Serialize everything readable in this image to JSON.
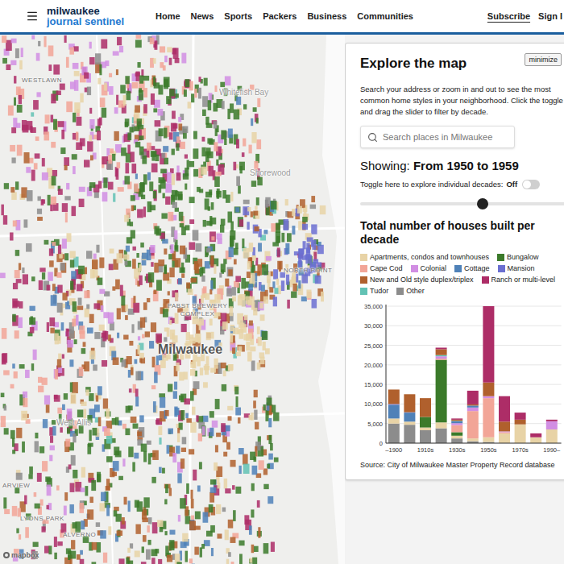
{
  "header": {
    "logo": {
      "line1": "milwaukee",
      "line2": "journal sentinel"
    },
    "nav": [
      {
        "label": "Home"
      },
      {
        "label": "News"
      },
      {
        "label": "Sports"
      },
      {
        "label": "Packers"
      },
      {
        "label": "Business"
      },
      {
        "label": "Communities"
      }
    ],
    "subscribe": "Subscribe",
    "sign_in": "Sign I"
  },
  "map": {
    "labels": [
      {
        "text": "WESTLAWN",
        "kind": "neighborhood"
      },
      {
        "text": "Whitefish Bay",
        "kind": "town"
      },
      {
        "text": "Shorewood",
        "kind": "town"
      },
      {
        "text": "NORTH POINT",
        "kind": "neighborhood"
      },
      {
        "text": "PABST BREWERY COMPLEX",
        "kind": "neighborhood"
      },
      {
        "text": "Milwaukee",
        "kind": "city"
      },
      {
        "text": "West Allis",
        "kind": "town"
      },
      {
        "text": "ARVIEW",
        "kind": "neighborhood"
      },
      {
        "text": "LYONS PARK",
        "kind": "neighborhood"
      },
      {
        "text": "ALVERNO",
        "kind": "neighborhood"
      }
    ],
    "attribution": "mapbox"
  },
  "panel": {
    "title": "Explore the map",
    "minimize": "minimize",
    "intro": "Search your address or zoom in and out to see the most common home styles in your neighborhood. Click the toggle and drag the slider to filter by decade.",
    "search": {
      "placeholder": "Search places in Milwaukee"
    },
    "showing_label": "Showing:",
    "showing_value": "From 1950 to 1959",
    "toggle": {
      "label": "Toggle here to explore individual decades:",
      "value": "Off",
      "on": false
    },
    "slider": {
      "level": 0.58
    },
    "chart": {
      "title": "Total number of houses built per decade",
      "y_ticks": [
        "0",
        "5,000",
        "10,000",
        "15,000",
        "20,000",
        "25,000",
        "30,000",
        "35,000"
      ],
      "x_labels": [
        "–1900",
        "",
        "1910s",
        "",
        "1930s",
        "",
        "1950s",
        "",
        "1970s",
        "",
        "1990–"
      ],
      "series": [
        {
          "name": "Apartments, condos and townhouses",
          "color": "#e8d3a6",
          "values": [
            1300,
            800,
            700,
            1500,
            700,
            700,
            1200,
            2500,
            4800,
            1500,
            3500
          ]
        },
        {
          "name": "Bungalow",
          "color": "#3b7a2a",
          "values": [
            0,
            0,
            2700,
            16000,
            900,
            0,
            0,
            0,
            0,
            0,
            0
          ]
        },
        {
          "name": "Cape Cod",
          "color": "#f2a597",
          "values": [
            0,
            0,
            0,
            300,
            1800,
            7000,
            10000,
            300,
            0,
            0,
            0
          ]
        },
        {
          "name": "Colonial",
          "color": "#d18ee3",
          "values": [
            0,
            0,
            0,
            600,
            500,
            900,
            500,
            200,
            0,
            0,
            2100
          ]
        },
        {
          "name": "Cottage",
          "color": "#4f81b8",
          "values": [
            3500,
            2300,
            0,
            0,
            500,
            500,
            0,
            0,
            0,
            0,
            0
          ]
        },
        {
          "name": "Mansion",
          "color": "#6b6fd1",
          "values": [
            200,
            100,
            0,
            0,
            0,
            0,
            0,
            0,
            0,
            0,
            0
          ]
        },
        {
          "name": "New and Old style duplex/triplex",
          "color": "#b0602d",
          "values": [
            3700,
            4600,
            4800,
            1500,
            300,
            300,
            3500,
            2500,
            1200,
            0,
            0
          ]
        },
        {
          "name": "Ranch or multi-level",
          "color": "#ad2d67",
          "values": [
            0,
            0,
            0,
            400,
            300,
            3500,
            19500,
            6500,
            1800,
            1000,
            400
          ]
        },
        {
          "name": "Tudor",
          "color": "#62c2b4",
          "values": [
            0,
            0,
            0,
            300,
            100,
            0,
            0,
            0,
            0,
            0,
            0
          ]
        },
        {
          "name": "Other",
          "color": "#8c8c8c",
          "values": [
            5000,
            4700,
            3300,
            3800,
            1200,
            500,
            300,
            0,
            0,
            0,
            0
          ]
        }
      ],
      "source": "Source: City of Milwaukee Master Property Record database"
    }
  }
}
